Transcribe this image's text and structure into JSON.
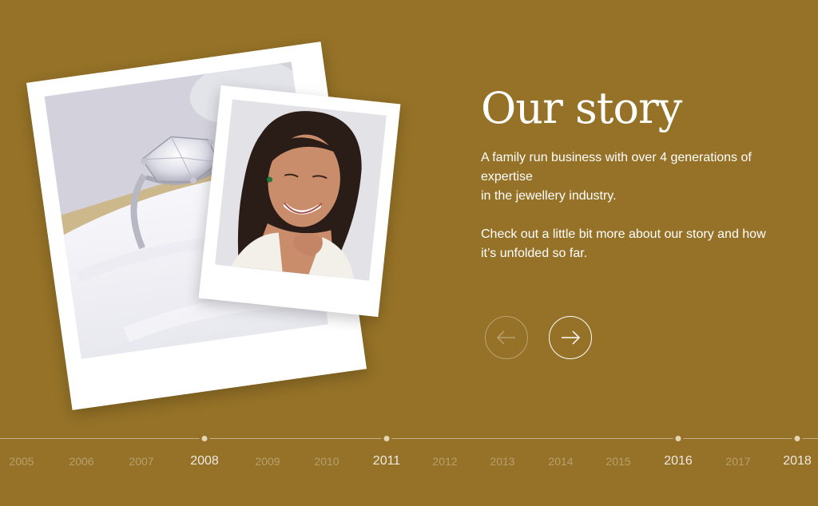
{
  "hero": {
    "title": "Our story",
    "paragraph_1_line_1": "A family run business with over 4 generations of expertise",
    "paragraph_1_line_2": "in the jewellery industry.",
    "paragraph_2": "Check out a little bit more about our story and how it’s unfolded so far."
  },
  "navigation": {
    "prev_icon": "arrow-left-icon",
    "next_icon": "arrow-right-icon",
    "prev_enabled": false,
    "next_enabled": true
  },
  "photos": {
    "back_photo": "ring-in-box-photo",
    "front_photo": "smiling-woman-portrait-photo"
  },
  "timeline": {
    "years": [
      "2005",
      "2006",
      "2007",
      "2008",
      "2009",
      "2010",
      "2011",
      "2012",
      "2013",
      "2014",
      "2015",
      "2016",
      "2017",
      "2018"
    ],
    "milestone_years": [
      "2008",
      "2011",
      "2016",
      "2018"
    ]
  },
  "colors": {
    "background": "#957227",
    "text": "#ffffff"
  }
}
